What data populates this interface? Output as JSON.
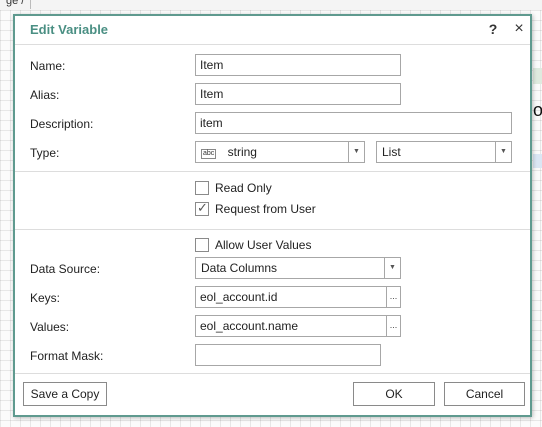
{
  "background": {
    "tab_label": "ge /",
    "side_text": "o"
  },
  "dialog": {
    "title": "Edit Variable",
    "help_icon": "?",
    "close_icon": "×"
  },
  "form": {
    "name_label": "Name:",
    "name_value": "Item",
    "alias_label": "Alias:",
    "alias_value": "Item",
    "description_label": "Description:",
    "description_value": "item",
    "type_label": "Type:",
    "type_icon_text": "abc",
    "type_value": "string",
    "type_mode": "List",
    "read_only_label": "Read Only",
    "read_only_checked": false,
    "request_user_label": "Request from User",
    "request_user_checked": true,
    "allow_user_values_label": "Allow User Values",
    "allow_user_values_checked": false,
    "data_source_label": "Data Source:",
    "data_source_value": "Data Columns",
    "keys_label": "Keys:",
    "keys_value": "eol_account.id",
    "values_label": "Values:",
    "values_value": "eol_account.name",
    "format_mask_label": "Format Mask:",
    "format_mask_value": "",
    "ellipsis": "..."
  },
  "footer": {
    "save_copy_label": "Save a Copy",
    "ok_label": "OK",
    "cancel_label": "Cancel"
  },
  "colors": {
    "accent": "#4a8f83",
    "dialog_border": "#5f9a8f"
  }
}
